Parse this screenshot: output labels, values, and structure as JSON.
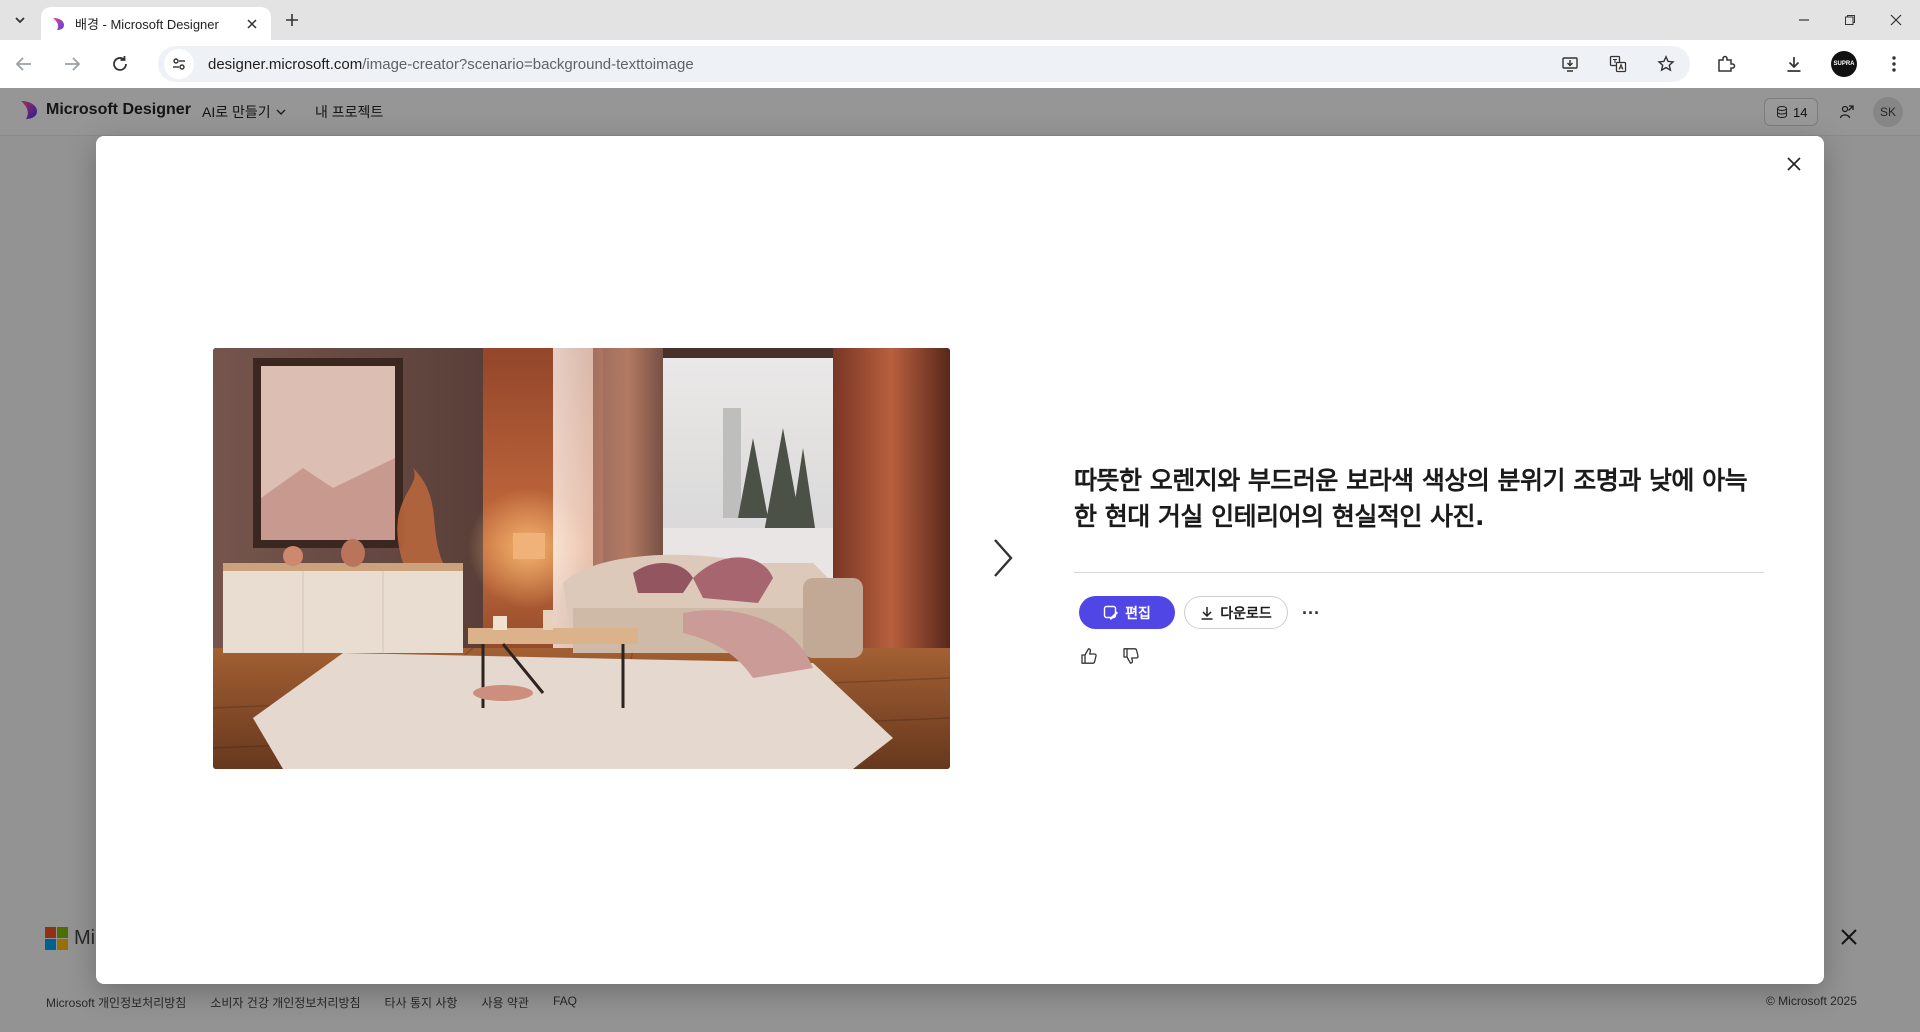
{
  "browser": {
    "tab_title": "배경 - Microsoft Designer",
    "url_host": "designer.microsoft.com",
    "url_path": "/image-creator?scenario=background-texttoimage",
    "profile_label": "SUPRA"
  },
  "app_header": {
    "brand_name": "Microsoft Designer",
    "menu_create": "AI로 만들기",
    "menu_projects": "내 프로젝트",
    "credits_count": "14",
    "avatar_initials": "SK"
  },
  "modal": {
    "prompt": "따뜻한 오렌지와 부드러운 보라색 색상의 분위기 조명과 낮에 아늑한 현대 거실 인테리어의 현실적인 사진.",
    "edit_label": "편집",
    "download_label": "다운로드",
    "more_label": "···"
  },
  "footer": {
    "brand_partial": "Mi",
    "links": [
      "Microsoft 개인정보처리방침",
      "소비자 건강 개인정보처리방침",
      "타사 통지 사항",
      "사용 약관",
      "FAQ"
    ],
    "copyright": "© Microsoft 2025"
  },
  "colors": {
    "accent": "#4f46e5",
    "chrome_bg": "#e3e3e3",
    "overlay": "rgba(0,0,0,0.4)"
  },
  "icons": {
    "tab_list": "chevron-down-icon",
    "back": "arrow-left-icon",
    "forward": "arrow-right-icon",
    "reload": "reload-icon",
    "install": "install-app-icon",
    "translate": "translate-icon",
    "bookmark": "star-icon",
    "extensions": "puzzle-icon",
    "downloads": "download-icon",
    "menu": "kebab-icon",
    "close": "close-icon",
    "next": "chevron-right-icon",
    "like": "thumbs-up-icon",
    "dislike": "thumbs-down-icon"
  }
}
